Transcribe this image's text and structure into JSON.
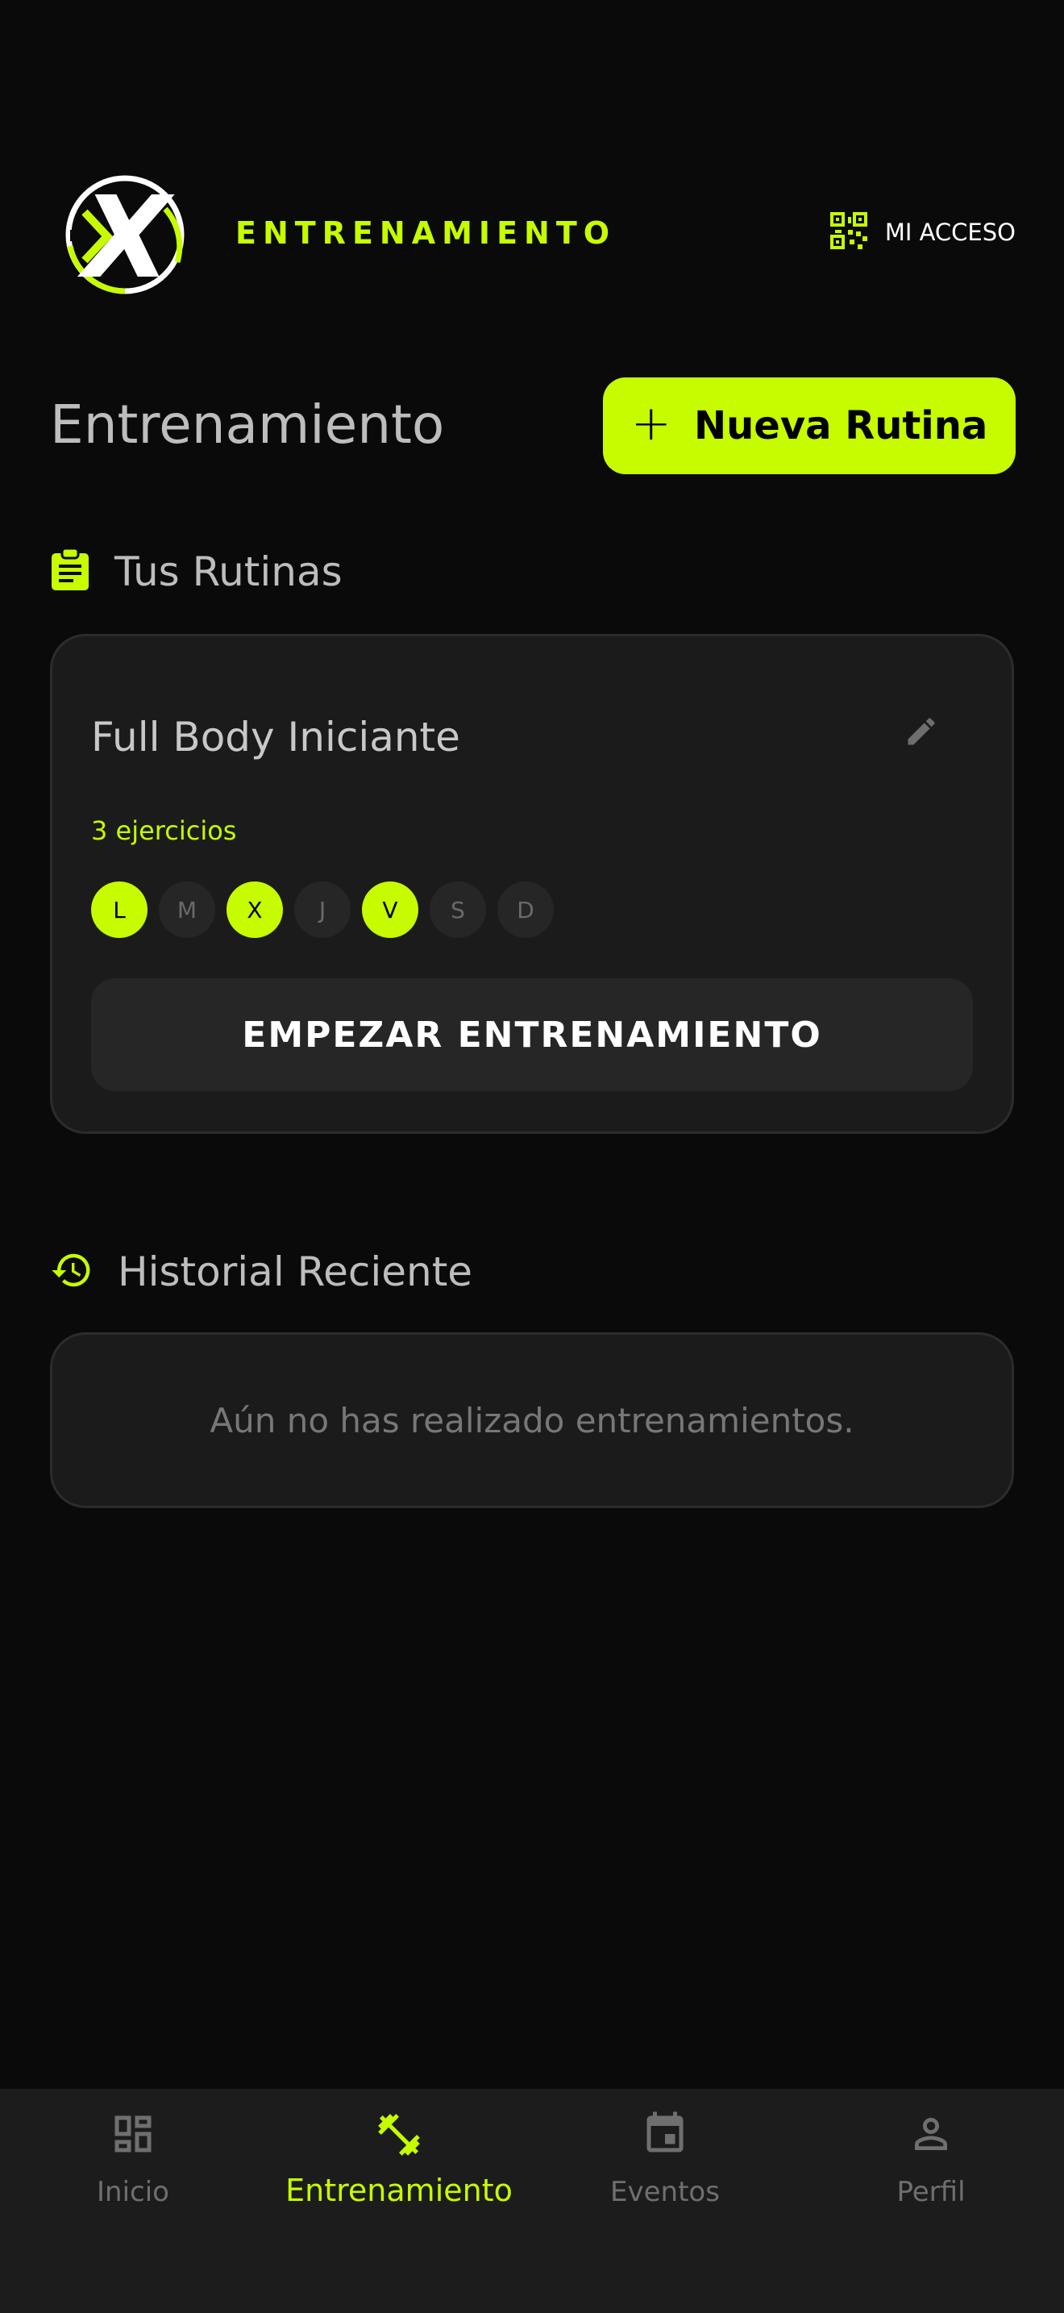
{
  "header": {
    "brand_title": "ENTRENAMIENTO",
    "access_label": "MI ACCESO",
    "logo_letter": "X"
  },
  "page": {
    "title": "Entrenamiento",
    "new_routine_label": "Nueva Rutina"
  },
  "routines": {
    "heading": "Tus Rutinas",
    "items": [
      {
        "name": "Full Body Iniciante",
        "exercise_count": "3 ejercicios",
        "days": [
          {
            "label": "L",
            "active": true
          },
          {
            "label": "M",
            "active": false
          },
          {
            "label": "X",
            "active": true
          },
          {
            "label": "J",
            "active": false
          },
          {
            "label": "V",
            "active": true
          },
          {
            "label": "S",
            "active": false
          },
          {
            "label": "D",
            "active": false
          }
        ],
        "start_label": "EMPEZAR ENTRENAMIENTO"
      }
    ]
  },
  "history": {
    "heading": "Historial Reciente",
    "empty_text": "Aún no has realizado entrenamientos."
  },
  "nav": {
    "items": [
      {
        "label": "Inicio",
        "icon": "dashboard-icon",
        "active": false
      },
      {
        "label": "Entrenamiento",
        "icon": "dumbbell-icon",
        "active": true
      },
      {
        "label": "Eventos",
        "icon": "calendar-icon",
        "active": false
      },
      {
        "label": "Perfil",
        "icon": "person-icon",
        "active": false
      }
    ]
  },
  "colors": {
    "accent": "#c6fb00",
    "background": "#0a0a0a",
    "card": "#1b1b1b",
    "nav": "#1c1c1c"
  }
}
